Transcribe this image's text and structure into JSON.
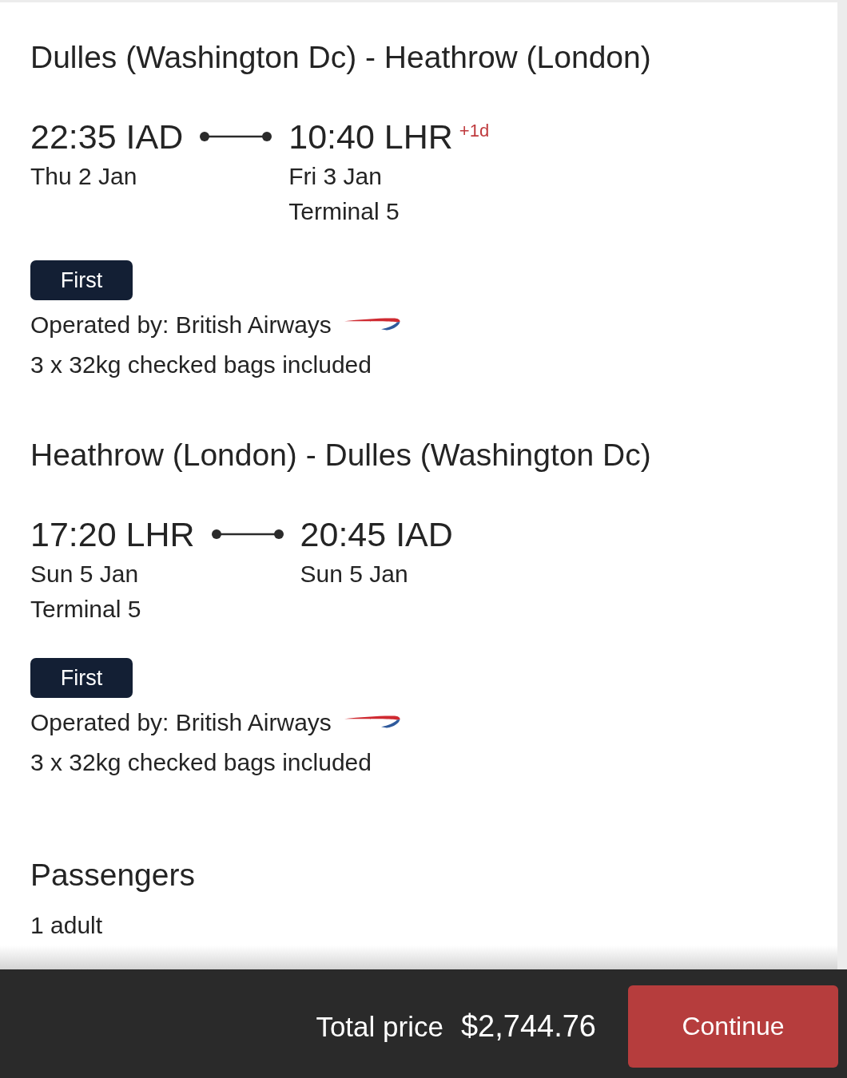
{
  "segments": [
    {
      "title": "Dulles (Washington Dc) - Heathrow (London)",
      "departure": {
        "time": "22:35 IAD",
        "date": "Thu 2 Jan"
      },
      "arrival": {
        "time": "10:40 LHR",
        "day_offset": "+1d",
        "date": "Fri 3 Jan",
        "terminal": "Terminal 5"
      },
      "cabin": "First",
      "operator": "Operated by: British Airways",
      "baggage": "3 x 32kg checked bags included"
    },
    {
      "title": "Heathrow (London) - Dulles (Washington Dc)",
      "departure": {
        "time": "17:20 LHR",
        "date": "Sun 5 Jan",
        "terminal": "Terminal 5"
      },
      "arrival": {
        "time": "20:45 IAD",
        "date": "Sun 5 Jan"
      },
      "cabin": "First",
      "operator": "Operated by: British Airways",
      "baggage": "3 x 32kg checked bags included"
    }
  ],
  "passengers": {
    "title": "Passengers",
    "summary": "1 adult"
  },
  "footer": {
    "total_label": "Total price",
    "total_value": "$2,744.76",
    "continue_button": "Continue"
  }
}
